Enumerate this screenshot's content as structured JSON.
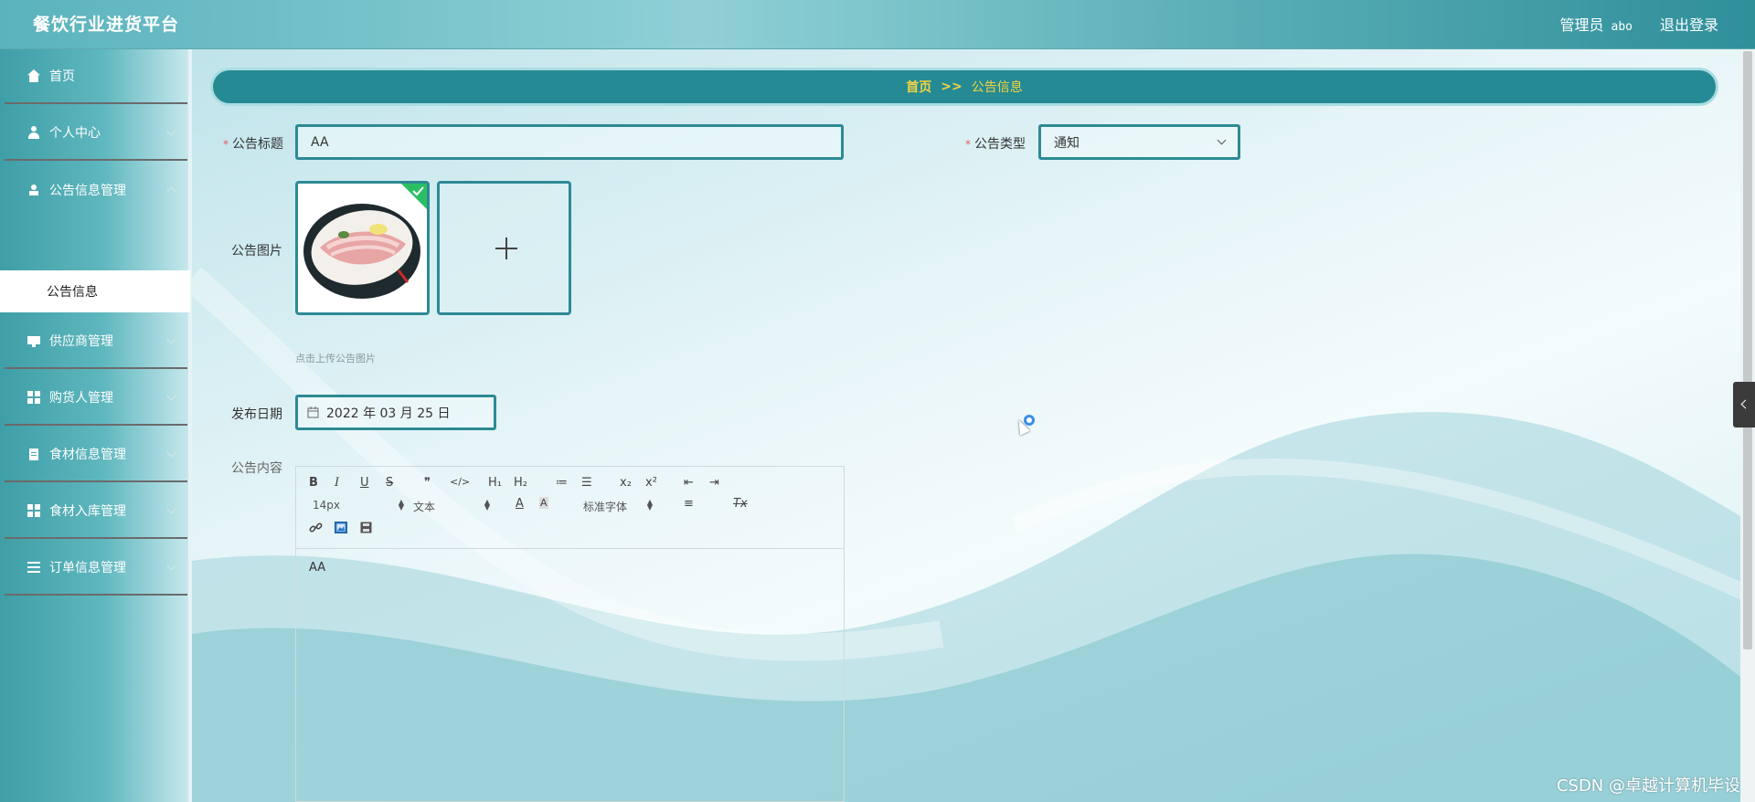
{
  "header": {
    "brand": "餐饮行业进货平台",
    "admin_label": "管理员",
    "username": "abo",
    "logout_label": "退出登录"
  },
  "sidebar": {
    "items": [
      {
        "label": "首页",
        "icon": "home-icon"
      },
      {
        "label": "个人中心",
        "icon": "user-icon"
      },
      {
        "label": "公告信息管理",
        "icon": "person-icon"
      },
      {
        "label": "供应商管理",
        "icon": "monitor-icon"
      },
      {
        "label": "购货人管理",
        "icon": "grid-icon"
      },
      {
        "label": "食材信息管理",
        "icon": "clipboard-icon"
      },
      {
        "label": "食材入库管理",
        "icon": "grid-icon"
      },
      {
        "label": "订单信息管理",
        "icon": "list-icon"
      }
    ],
    "active_sub": "公告信息"
  },
  "breadcrumb": {
    "home": "首页",
    "separator": ">>",
    "current": "公告信息"
  },
  "form": {
    "title_label": "公告标题",
    "title_value": "AA",
    "type_label": "公告类型",
    "type_value": "通知",
    "image_label": "公告图片",
    "image_hint": "点击上传公告图片",
    "date_label": "发布日期",
    "date_value": "2022 年 03 月 25 日",
    "content_label": "公告内容",
    "content_value": "AA"
  },
  "editor": {
    "toolbar": {
      "bold": "B",
      "italic": "I",
      "underline": "U",
      "strike": "S",
      "quote": "❞",
      "code": "</>",
      "h1": "H₁",
      "h2": "H₂",
      "ordered_list": "≔",
      "bullet_list": "☰",
      "sub": "x₂",
      "sup": "x²",
      "outdent": "⇤",
      "indent": "⇥",
      "size": "14px",
      "para": "文本",
      "font": "标准字体",
      "color": "A",
      "bgcolor": "A",
      "align": "≡",
      "clear": "Tx"
    }
  },
  "watermark": "CSDN @卓越计算机毕设"
}
